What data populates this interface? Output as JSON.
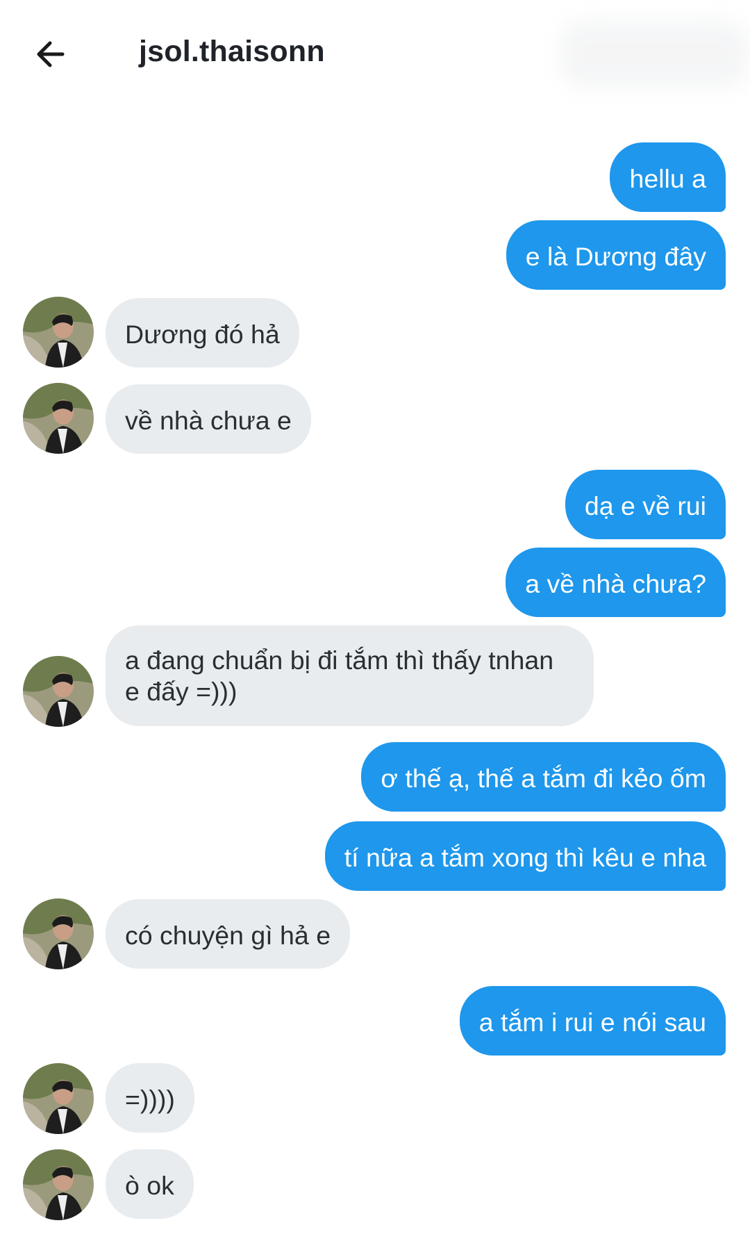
{
  "header": {
    "title": "jsol.thaisonn",
    "back_icon": "arrow-left-icon"
  },
  "colors": {
    "outgoing_bubble": "#1e97ec",
    "incoming_bubble": "#e9ecef",
    "background": "#ffffff"
  },
  "messages": [
    {
      "direction": "outgoing",
      "text": "hellu a"
    },
    {
      "direction": "outgoing",
      "text": "e là Dương đây"
    },
    {
      "direction": "incoming",
      "text": "Dương đó hả"
    },
    {
      "direction": "incoming",
      "text": "về nhà chưa e"
    },
    {
      "direction": "outgoing",
      "text": "dạ e về rui"
    },
    {
      "direction": "outgoing",
      "text": "a về nhà chưa?"
    },
    {
      "direction": "incoming",
      "text": "a đang chuẩn bị đi tắm thì thấy tnhan e đấy =)))"
    },
    {
      "direction": "outgoing",
      "text": "ơ thế ạ, thế a tắm đi kẻo ốm"
    },
    {
      "direction": "outgoing",
      "text": "tí nữa a tắm xong thì kêu e nha"
    },
    {
      "direction": "incoming",
      "text": "có chuyện gì hả e"
    },
    {
      "direction": "outgoing",
      "text": "a tắm i rui e nói sau"
    },
    {
      "direction": "incoming",
      "text": "=))))"
    },
    {
      "direction": "incoming",
      "text": "ò ok"
    }
  ]
}
